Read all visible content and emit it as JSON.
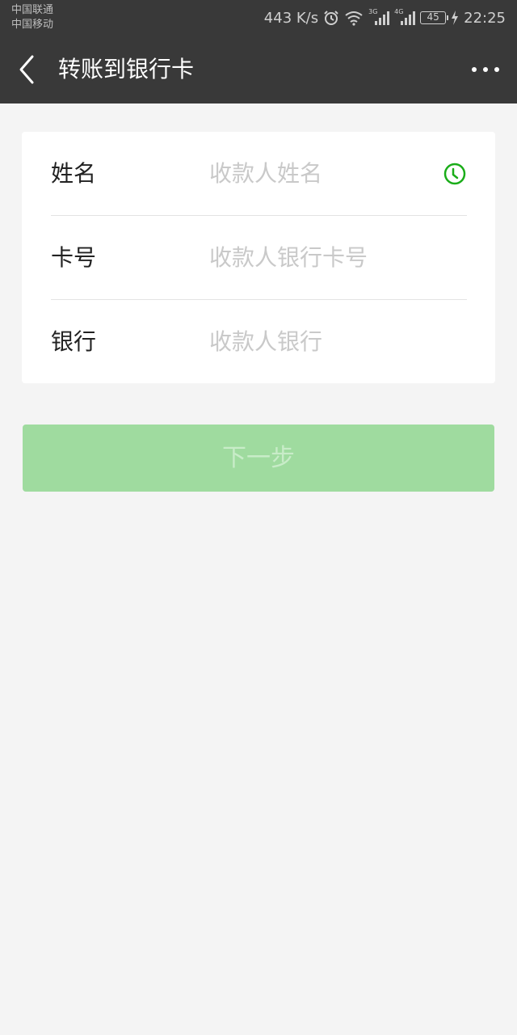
{
  "status_bar": {
    "carrier_1": "中国联通",
    "carrier_2": "中国移动",
    "network_speed": "443 K/s",
    "signal_1_tag": "3G",
    "signal_2_tag": "4G",
    "battery_level": "45",
    "time": "22:25",
    "icons": [
      "alarm-icon",
      "wifi-icon",
      "signal-icon",
      "battery-icon",
      "charging-icon"
    ]
  },
  "nav": {
    "title": "转账到银行卡",
    "back_icon": "chevron-left-icon",
    "more_icon": "more-dots-icon"
  },
  "form": {
    "name": {
      "label": "姓名",
      "placeholder": "收款人姓名",
      "icon": "history-icon"
    },
    "card_number": {
      "label": "卡号",
      "placeholder": "收款人银行卡号"
    },
    "bank": {
      "label": "银行",
      "placeholder": "收款人银行"
    }
  },
  "next_button": {
    "label": "下一步"
  },
  "colors": {
    "header_bg": "#393939",
    "page_bg": "#f4f4f4",
    "accent_green": "#1aad19",
    "button_disabled_bg": "#9fdb9f"
  }
}
